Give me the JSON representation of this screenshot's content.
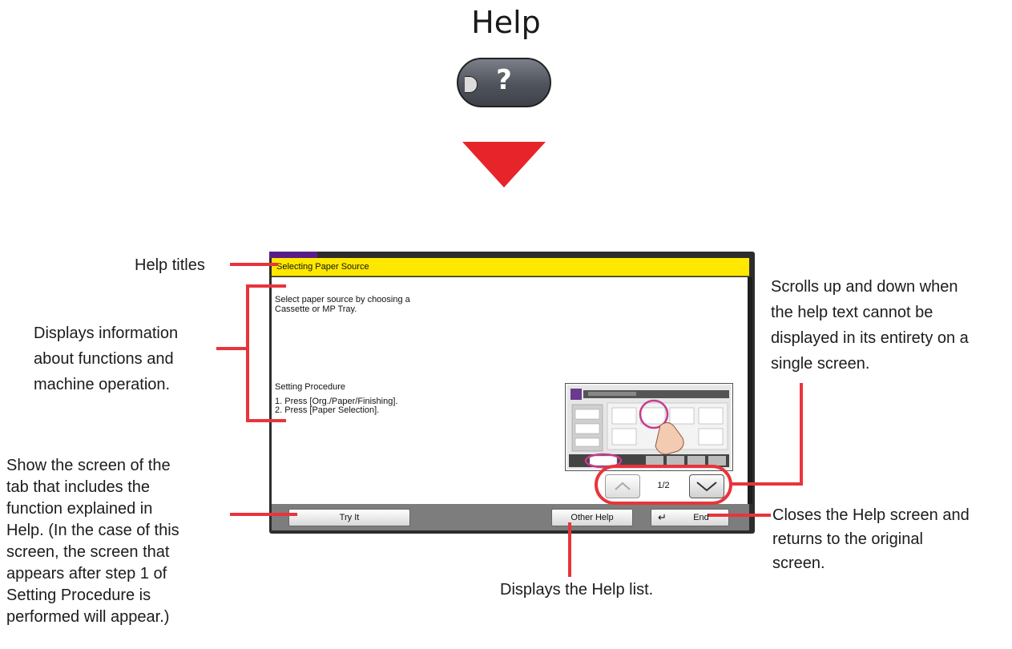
{
  "heading": "Help",
  "hardware_key": {
    "symbol": "?"
  },
  "help_screen": {
    "title": "Selecting Paper Source",
    "description": [
      "Select paper source by choosing a",
      "Cassette or MP Tray."
    ],
    "procedure_heading": "Setting Procedure",
    "steps": [
      "1. Press [Org./Paper/Finishing].",
      "2. Press [Paper Selection]."
    ],
    "page_indicator": "1/2",
    "buttons": {
      "try_it": "Try It",
      "other_help": "Other Help",
      "end": "End"
    },
    "colors": {
      "title_bar": "#ffe800",
      "accent": "#5a1f86",
      "frame": "#2d2d2d"
    }
  },
  "callouts": {
    "help_titles": "Help titles",
    "displays_info": [
      "Displays information",
      "about functions and",
      "machine operation."
    ],
    "scrolls": [
      "Scrolls up and down when",
      "the help text cannot be",
      "displayed in its entirety on a",
      "single screen."
    ],
    "show_screen": [
      "Show the screen of the",
      "tab that includes the",
      "function explained in",
      "Help. (In the case of this",
      "screen, the screen that",
      "appears after step 1 of",
      "Setting Procedure is",
      "performed will appear.)"
    ],
    "closes": [
      "Closes the Help screen and",
      "returns to the original",
      "screen."
    ],
    "help_list": "Displays the Help list."
  },
  "colors": {
    "callout_line": "#e8343b",
    "arrow": "#e8242b"
  }
}
